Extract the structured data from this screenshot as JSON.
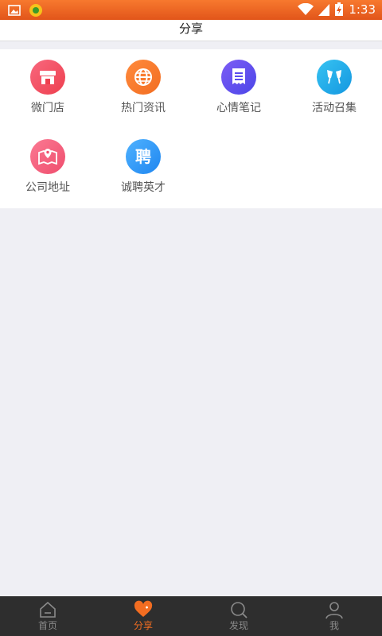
{
  "status_bar": {
    "time": "1:33"
  },
  "header": {
    "title": "分享"
  },
  "grid_items": [
    {
      "label": "微门店",
      "icon": "store-icon",
      "color_from": "#f8687e",
      "color_to": "#ee3f4e"
    },
    {
      "label": "热门资讯",
      "icon": "globe-icon",
      "color_from": "#ff8a3d",
      "color_to": "#f26d21"
    },
    {
      "label": "心情笔记",
      "icon": "note-icon",
      "color_from": "#7d5cf5",
      "color_to": "#4b46e8"
    },
    {
      "label": "活动召集",
      "icon": "cheers-icon",
      "color_from": "#37c3f2",
      "color_to": "#1497e0"
    },
    {
      "label": "公司地址",
      "icon": "map-pin-icon",
      "color_from": "#fb7a93",
      "color_to": "#ef4d6d"
    },
    {
      "label": "诚聘英才",
      "icon": "recruit-icon",
      "glyph": "聘",
      "color_from": "#4fb2ff",
      "color_to": "#1f86f0"
    }
  ],
  "tabs": [
    {
      "label": "首页",
      "icon": "home-icon",
      "active": false
    },
    {
      "label": "分享",
      "icon": "heart-icon",
      "active": true
    },
    {
      "label": "发现",
      "icon": "search-icon",
      "active": false
    },
    {
      "label": "我",
      "icon": "user-icon",
      "active": false
    }
  ],
  "colors": {
    "accent": "#f26d21",
    "tabbar_bg": "#2e2e2e",
    "page_bg": "#efeff4"
  }
}
